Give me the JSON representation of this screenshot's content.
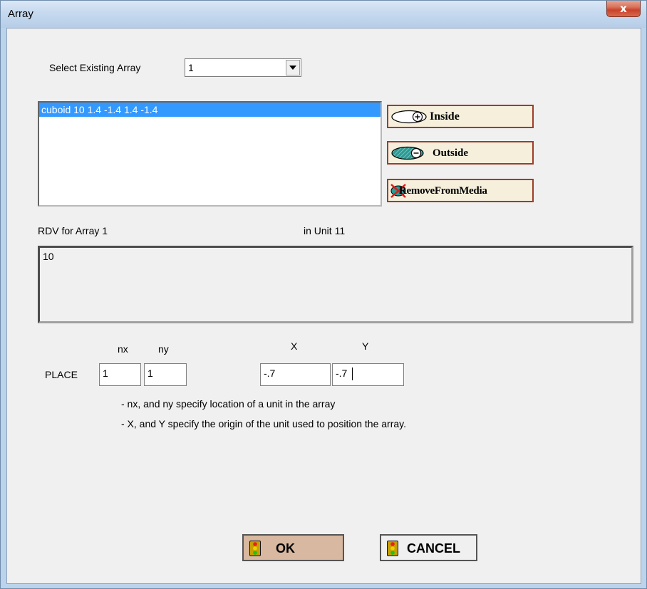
{
  "window": {
    "title": "Array",
    "close_label": "x"
  },
  "select_array": {
    "label": "Select Existing Array",
    "value": "1"
  },
  "region_list": {
    "items": [
      "cuboid 10  1.4  -1.4  1.4  -1.4"
    ],
    "selected_index": 0
  },
  "media_buttons": {
    "inside": "Inside",
    "outside": "Outside",
    "remove": "RemoveFromMedia"
  },
  "rdv": {
    "label": "RDV for Array 1",
    "unit_label": "in Unit 11",
    "value": "10"
  },
  "place": {
    "label": "PLACE",
    "nx_header": "nx",
    "ny_header": "ny",
    "x_header": "X",
    "y_header": "Y",
    "nx": "1",
    "ny": "1",
    "x": "-.7",
    "y": "-.7",
    "note1": "- nx, and ny specify location of a unit in the array",
    "note2": "- X, and Y specify the origin of the unit used to position the array."
  },
  "actions": {
    "ok": "OK",
    "cancel": "CANCEL"
  },
  "colors": {
    "selection": "#3399ff",
    "media_border": "#9c3e2a",
    "media_fill": "#f5efdc",
    "ok_fill": "#d8b8a0",
    "inside_icon": "#ffffff",
    "outside_icon": "#2a9a94"
  },
  "icons": {
    "inside": "ellipse-plus-icon",
    "outside": "ellipse-minus-icon",
    "remove": "red-x-icon",
    "ok": "traffic-light-icon",
    "cancel": "traffic-light-icon",
    "dropdown": "chevron-down-icon"
  }
}
